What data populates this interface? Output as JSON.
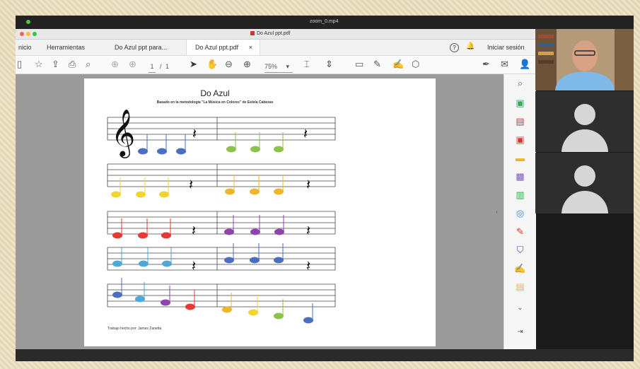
{
  "zoom_window": {
    "title": "zoom_0.mp4"
  },
  "window": {
    "title": "Do Azul ppt.pdf"
  },
  "tabs": [
    {
      "label": "nicio"
    },
    {
      "label": "Herramientas"
    },
    {
      "label": "Do Azul ppt para..."
    },
    {
      "label": "Do Azul ppt.pdf",
      "close": "×"
    }
  ],
  "header": {
    "signin": "Iniciar sesión",
    "help": "?"
  },
  "toolbar": {
    "page_current": "1",
    "page_sep": "/",
    "page_total": "1",
    "zoom": "75%"
  },
  "document": {
    "title": "Do Azul",
    "subtitle": "Basado en la metodología \"La Música en Colores\" de Estela Cabezas",
    "footer": "Trabajo hecho por: James Zanetta"
  },
  "colors": {
    "do": "#4a6fc1",
    "re": "#8bc34a",
    "mi": "#f2d431",
    "fa": "#f0b62b",
    "sol": "#e53935",
    "la": "#8e44ad",
    "si": "#4fa9d8",
    "accent": "#d9342b"
  }
}
